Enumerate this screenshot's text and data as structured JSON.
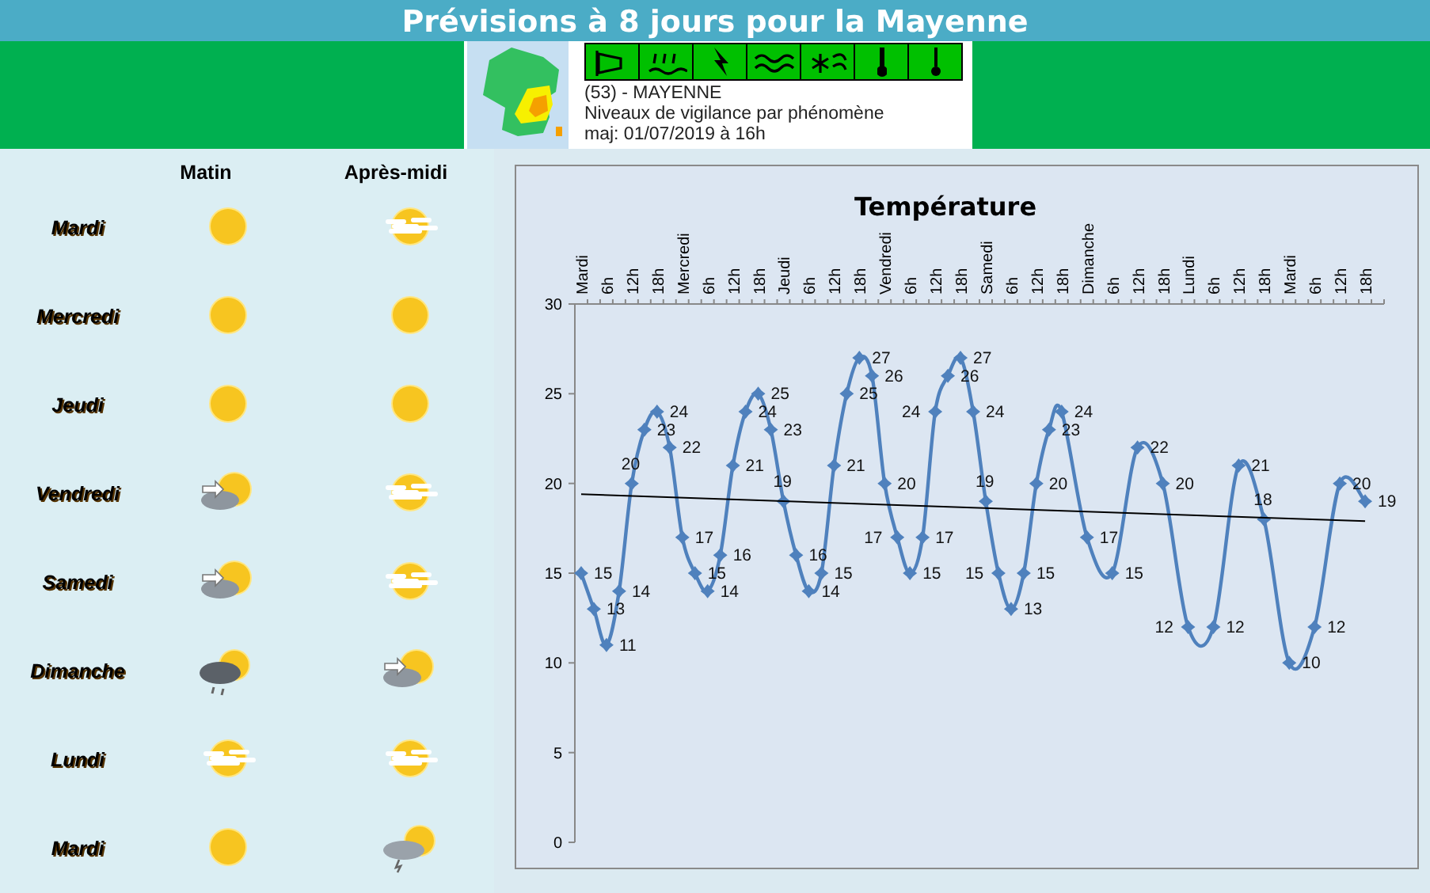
{
  "header": {
    "title": "Prévisions à 8 jours pour la Mayenne"
  },
  "vigilance": {
    "phenomena": [
      {
        "kind": "wind",
        "color": "#00c000"
      },
      {
        "kind": "flood",
        "color": "#00c000"
      },
      {
        "kind": "storm",
        "color": "#00c000"
      },
      {
        "kind": "waves",
        "color": "#00c000"
      },
      {
        "kind": "snow",
        "color": "#00c000"
      },
      {
        "kind": "heat",
        "color": "#00c000"
      },
      {
        "kind": "cold",
        "color": "#00c000"
      }
    ],
    "lines": [
      "(53) - MAYENNE",
      "Niveaux de vigilance par phénomène",
      "maj: 01/07/2019 à 16h"
    ]
  },
  "forecast": {
    "columns": [
      "Matin",
      "Après-midi"
    ],
    "days": [
      {
        "name": "Mardi",
        "morning": {
          "kind": "sun"
        },
        "afternoon": {
          "kind": "veiled"
        }
      },
      {
        "name": "Mercredi",
        "morning": {
          "kind": "sun"
        },
        "afternoon": {
          "kind": "sun"
        }
      },
      {
        "name": "Jeudi",
        "morning": {
          "kind": "sun"
        },
        "afternoon": {
          "kind": "sun"
        }
      },
      {
        "name": "Vendredi",
        "morning": {
          "kind": "cloudy"
        },
        "afternoon": {
          "kind": "veiled"
        }
      },
      {
        "name": "Samedi",
        "morning": {
          "kind": "cloudy"
        },
        "afternoon": {
          "kind": "veiled"
        }
      },
      {
        "name": "Dimanche",
        "morning": {
          "kind": "showers"
        },
        "afternoon": {
          "kind": "cloudy"
        }
      },
      {
        "name": "Lundi",
        "morning": {
          "kind": "veiled"
        },
        "afternoon": {
          "kind": "veiled"
        }
      },
      {
        "name": "Mardi",
        "morning": {
          "kind": "sun"
        },
        "afternoon": {
          "kind": "thunder"
        }
      }
    ]
  },
  "chart_data": {
    "type": "line",
    "title": "Température",
    "ylim": [
      0,
      30
    ],
    "yticks": [
      0,
      5,
      10,
      15,
      20,
      25,
      30
    ],
    "categories": [
      "Mardi",
      null,
      "6h",
      null,
      "12h",
      null,
      "18h",
      null,
      "Mercredi",
      null,
      "6h",
      null,
      "12h",
      null,
      "18h",
      null,
      "Jeudi",
      null,
      "6h",
      null,
      "12h",
      null,
      "18h",
      null,
      "Vendredi",
      null,
      "6h",
      null,
      "12h",
      null,
      "18h",
      null,
      "Samedi",
      null,
      "6h",
      null,
      "12h",
      null,
      "18h",
      null,
      "Dimanche",
      null,
      "6h",
      null,
      "12h",
      null,
      "18h",
      null,
      "Lundi",
      null,
      "6h",
      null,
      "12h",
      null,
      "18h",
      null,
      "Mardi",
      null,
      "6h",
      null,
      "12h",
      null,
      "18h",
      null
    ],
    "series": [
      {
        "color": "#4f81bd",
        "marker": "diamond",
        "values": [
          15,
          13,
          11,
          14,
          20,
          23,
          24,
          22,
          17,
          15,
          14,
          16,
          21,
          24,
          25,
          23,
          19,
          16,
          14,
          15,
          21,
          25,
          27,
          26,
          20,
          17,
          15,
          17,
          24,
          26,
          27,
          24,
          19,
          15,
          13,
          15,
          20,
          23,
          24,
          null,
          17,
          null,
          15,
          null,
          22,
          null,
          20,
          null,
          12,
          null,
          12,
          null,
          21,
          null,
          18,
          null,
          10,
          null,
          12,
          null,
          20,
          null,
          19,
          null
        ],
        "value_labels": [
          "15",
          "13",
          "11",
          "14",
          "20",
          "23",
          "24",
          "22",
          "17",
          "15",
          "14",
          "16",
          "21",
          "24",
          "25",
          "23",
          "19",
          "16",
          "14",
          "15",
          "21",
          "25",
          "27",
          "26",
          "20",
          "17",
          "15",
          "17",
          "24",
          "26",
          "27",
          "24",
          "19",
          "15",
          "13",
          "15",
          "20",
          "23",
          "24",
          null,
          "17",
          null,
          "15",
          null,
          "22",
          null,
          "20",
          null,
          "12",
          null,
          "12",
          null,
          "21",
          null,
          "18",
          null,
          "10",
          null,
          "12",
          null,
          "20",
          null,
          "19",
          null
        ]
      },
      {
        "color": "#000000",
        "values": [
          19.4,
          null,
          null,
          null,
          null,
          null,
          null,
          null,
          null,
          null,
          null,
          null,
          null,
          null,
          null,
          null,
          null,
          null,
          null,
          null,
          null,
          null,
          null,
          null,
          null,
          null,
          null,
          null,
          null,
          null,
          null,
          null,
          null,
          null,
          null,
          null,
          null,
          null,
          null,
          null,
          null,
          null,
          null,
          null,
          null,
          null,
          null,
          null,
          null,
          null,
          null,
          null,
          null,
          null,
          null,
          null,
          null,
          null,
          null,
          null,
          null,
          null,
          17.9,
          null
        ]
      }
    ]
  }
}
